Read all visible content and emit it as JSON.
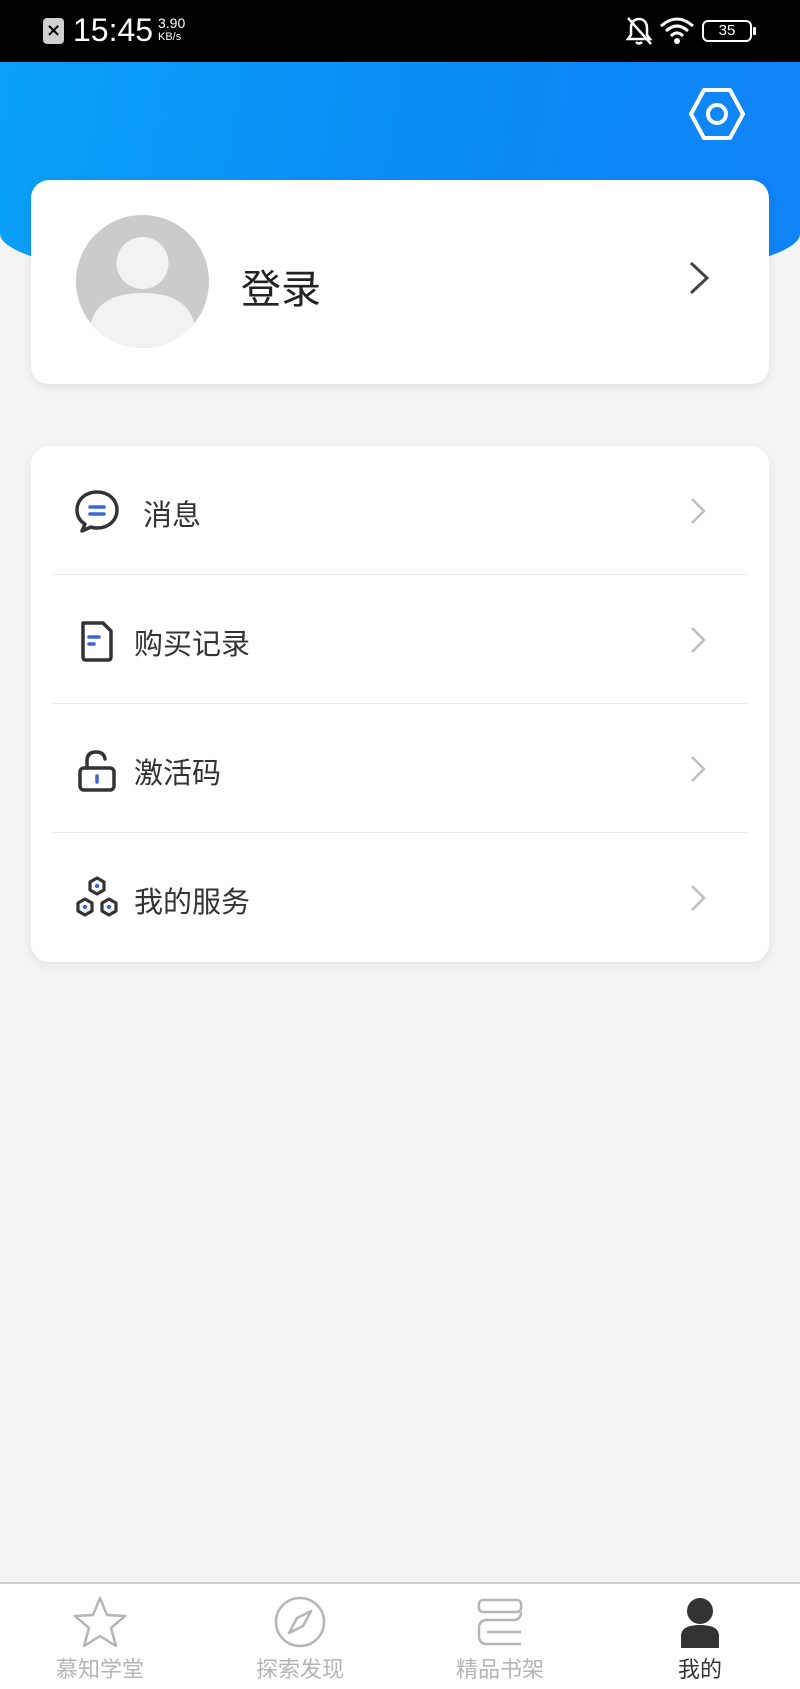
{
  "status_bar": {
    "time": "15:45",
    "net_speed_value": "3.90",
    "net_speed_unit": "KB/s",
    "battery": "35",
    "notification_icon": "close-box-icon",
    "icons": [
      "bell-muted-icon",
      "wifi-icon",
      "battery-icon"
    ]
  },
  "header": {
    "settings_icon": "settings-hexagon-icon",
    "gradient_colors": [
      "#0aa0f7",
      "#1083f6"
    ]
  },
  "login_card": {
    "label": "登录",
    "avatar_icon": "default-avatar-icon"
  },
  "menu": {
    "items": [
      {
        "label": "消息",
        "icon": "message-bubble-icon"
      },
      {
        "label": "购买记录",
        "icon": "document-icon"
      },
      {
        "label": "激活码",
        "icon": "unlock-icon"
      },
      {
        "label": "我的服务",
        "icon": "services-icon"
      }
    ]
  },
  "bottom_nav": {
    "items": [
      {
        "label": "慕知学堂",
        "icon": "star-icon",
        "active": false
      },
      {
        "label": "探索发现",
        "icon": "compass-icon",
        "active": false
      },
      {
        "label": "精品书架",
        "icon": "bookshelf-icon",
        "active": false
      },
      {
        "label": "我的",
        "icon": "user-icon",
        "active": true
      }
    ]
  },
  "colors": {
    "accent": "#0a8cf6",
    "background": "#f4f4f4",
    "nav_inactive": "#b5b5b5",
    "nav_active": "#333333",
    "menu_icon_highlight": "#3a66d6"
  }
}
